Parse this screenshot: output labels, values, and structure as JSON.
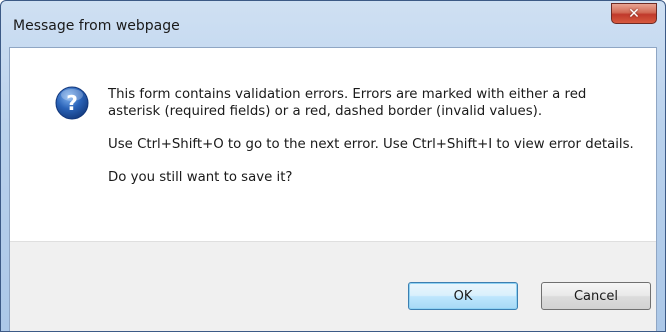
{
  "window": {
    "title": "Message from webpage",
    "close_glyph": "✕"
  },
  "icon": {
    "name": "question-icon",
    "glyph": "?",
    "color": "#2a63b8"
  },
  "message": {
    "paragraph1": "This form contains validation errors. Errors are marked with either a red asterisk (required fields) or a red, dashed border (invalid values).",
    "paragraph2": "Use Ctrl+Shift+O to go to the next error. Use Ctrl+Shift+I to view error details.",
    "paragraph3": "Do you still want to save it?"
  },
  "buttons": {
    "ok_label": "OK",
    "cancel_label": "Cancel"
  }
}
